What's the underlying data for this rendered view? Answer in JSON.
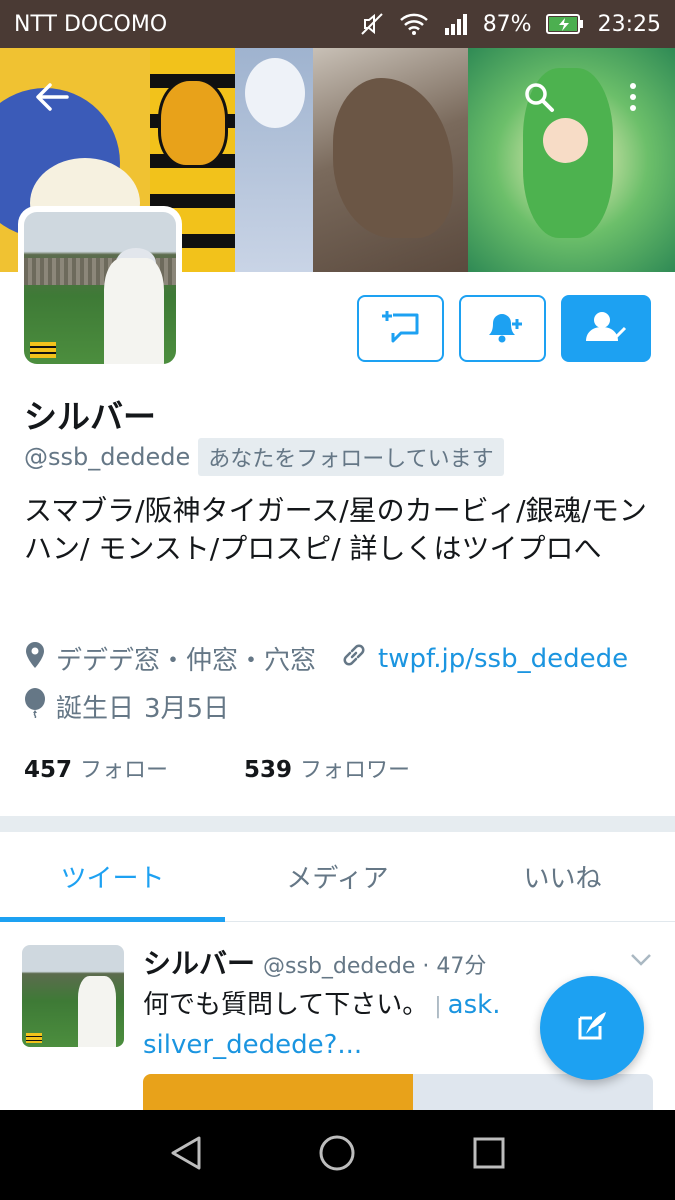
{
  "status_bar": {
    "carrier": "NTT DOCOMO",
    "battery_percent": "87%",
    "time": "23:25",
    "icons": [
      "mute-icon",
      "wifi-icon",
      "signal-icon",
      "battery-charging-icon"
    ]
  },
  "header": {
    "icons": [
      "back-arrow-icon",
      "search-icon",
      "more-vertical-icon"
    ]
  },
  "profile": {
    "display_name": "シルバー",
    "handle": "@ssb_dedede",
    "follows_you_badge": "あなたをフォローしています",
    "bio": "スマブラ/阪神タイガース/星のカービィ/銀魂/モンハン/ モンスト/プロスピ/ 詳しくはツイプロへ",
    "location": "デデデ窓・仲窓・穴窓",
    "website": "twpf.jp/ssb_dedede",
    "birthday_label": "誕生日",
    "birthday_value": "3月5日",
    "following_count": "457",
    "following_label": "フォロー",
    "followers_count": "539",
    "followers_label": "フォロワー"
  },
  "actions": {
    "icons": [
      "direct-message-icon",
      "notification-bell-icon",
      "following-check-icon"
    ]
  },
  "tabs": [
    {
      "label": "ツイート",
      "active": true
    },
    {
      "label": "メディア",
      "active": false
    },
    {
      "label": "いいね",
      "active": false
    }
  ],
  "tweet": {
    "name": "シルバー",
    "handle_time": "@ssb_dedede · 47分",
    "text": "何でも質問して下さい。",
    "separator": "|",
    "link_text_line1": "ask.",
    "link_text_line2": "silver_dedede?..."
  },
  "fab": {
    "icon": "compose-tweet-icon"
  },
  "nav_bar": {
    "icons": [
      "nav-back-icon",
      "nav-home-icon",
      "nav-recents-icon"
    ]
  },
  "colors": {
    "accent": "#1da1f2",
    "status_bar": "#4a3a34",
    "secondary_text": "#657786"
  }
}
